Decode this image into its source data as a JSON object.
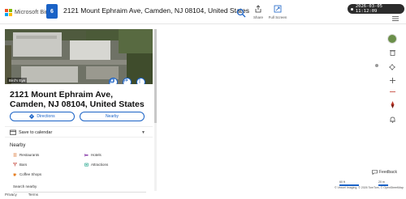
{
  "header": {
    "brand": "Microsoft Bing",
    "badge": "6",
    "title": "2121 Mount Ephraim Ave, Camden, NJ 08104, United States",
    "share_label": "Share",
    "fullscreen_label": "Full Screen",
    "timestamp": "2026-03-05 11:12:09"
  },
  "panel": {
    "photo_caption": "Bird's Eye",
    "place_title": "2121 Mount Ephraim Ave, Camden, NJ 08104, United States",
    "directions_label": "Directions",
    "nearby_btn_label": "Nearby",
    "save_label": "Save to calendar",
    "nearby_heading": "Nearby",
    "nearby_items": {
      "restaurants": "Restaurants",
      "hotels": "Hotels",
      "bars": "Bars",
      "attractions": "Attractions",
      "coffee": "Coffee Shops"
    },
    "search_nearby": "Search nearby"
  },
  "footer": {
    "privacy": "Privacy",
    "terms": "Terms"
  },
  "map": {
    "feedback_label": "Feedback",
    "scale_left": "60 ft",
    "scale_right": "20 m",
    "attribution": "© Vexcel Imaging, © 2026 TomTom, © OpenStreetMap"
  },
  "colors": {
    "accent": "#1a62c6",
    "timestamp_bg": "#2c2c2c"
  }
}
